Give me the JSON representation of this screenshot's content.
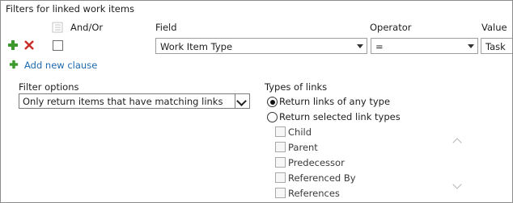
{
  "header": {
    "title": "Filters for linked work items"
  },
  "columns": {
    "andor": "And/Or",
    "field": "Field",
    "operator": "Operator",
    "value": "Value"
  },
  "clause": {
    "field_value": "Work Item Type",
    "operator_value": "=",
    "value_value": "Task"
  },
  "add_clause": {
    "label": "Add new clause"
  },
  "filter_options": {
    "label": "Filter options",
    "selected": "Only return items that have matching links"
  },
  "types_of_links": {
    "label": "Types of links",
    "options": [
      {
        "label": "Return links of any type",
        "selected": true
      },
      {
        "label": "Return selected link types",
        "selected": false
      }
    ],
    "link_types": [
      "Child",
      "Parent",
      "Predecessor",
      "Referenced By",
      "References"
    ]
  },
  "colors": {
    "accent": "#1e6ab0",
    "add_green": "#3c9a2c",
    "delete_red": "#c9302c"
  },
  "icons": {
    "add": "plus-icon",
    "delete": "x-icon",
    "grouping": "grouping-icon",
    "dropdown": "chevron-down-icon"
  }
}
